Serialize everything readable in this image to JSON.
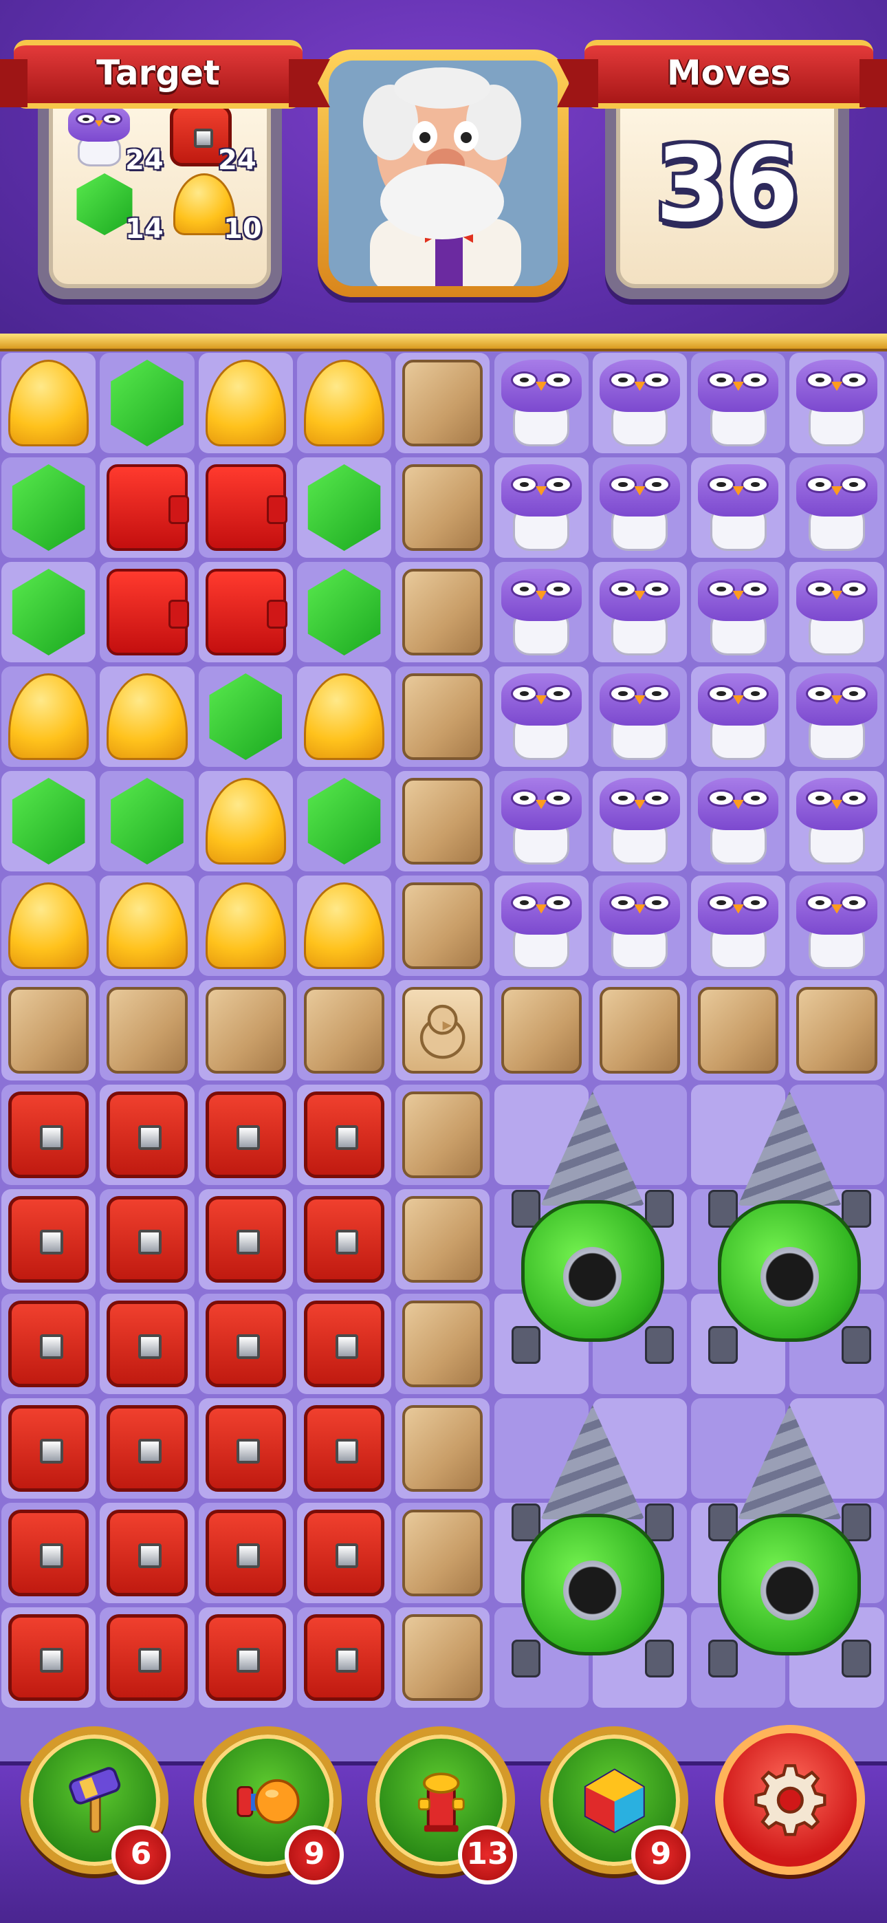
{
  "header": {
    "target_label": "Target",
    "moves_label": "Moves",
    "moves_value": "36",
    "targets": [
      {
        "icon": "owl-icon",
        "count": "24"
      },
      {
        "icon": "red-crate-icon",
        "count": "24"
      },
      {
        "icon": "green-gem-icon",
        "count": "14"
      },
      {
        "icon": "bell-icon",
        "count": "10"
      }
    ]
  },
  "boosters": [
    {
      "icon": "hammer-icon",
      "count": "6"
    },
    {
      "icon": "boxing-glove-icon",
      "count": "9"
    },
    {
      "icon": "fire-hydrant-icon",
      "count": "13"
    },
    {
      "icon": "magic-cube-icon",
      "count": "9"
    }
  ],
  "settings_icon": "gear-icon",
  "colors": {
    "background": "#5a2fa0",
    "board": "#8b72d6",
    "ribbon": "#d42828",
    "gold": "#f7c64a"
  }
}
